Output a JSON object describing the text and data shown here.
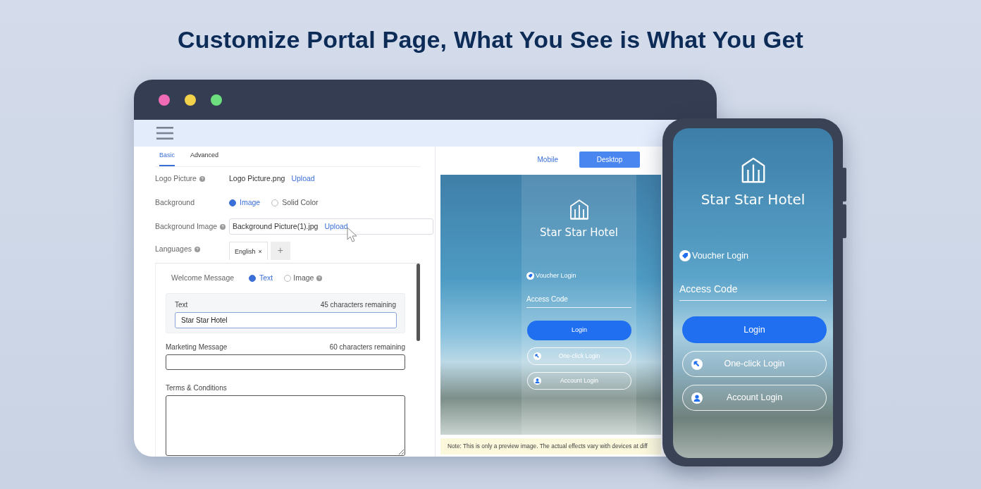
{
  "headline": "Customize Portal Page, What You See is What You Get",
  "settings": {
    "tabs": [
      {
        "label": "Basic",
        "selected": true
      },
      {
        "label": "Advanced",
        "selected": false
      }
    ],
    "logo_picture": {
      "label": "Logo Picture",
      "file": "Logo Picture.png",
      "action": "Upload"
    },
    "background": {
      "label": "Background",
      "options": [
        {
          "label": "Image",
          "selected": true
        },
        {
          "label": "Solid Color",
          "selected": false
        }
      ]
    },
    "background_image": {
      "label": "Background Image",
      "file": "Background Picture(1).jpg",
      "action": "Upload"
    },
    "languages": {
      "label": "Languages",
      "tabs": [
        {
          "label": "English",
          "close": "×"
        }
      ],
      "add": "+"
    },
    "welcome_message": {
      "label": "Welcome Message",
      "options": [
        {
          "label": "Text",
          "selected": true
        },
        {
          "label": "Image",
          "selected": false
        }
      ],
      "text_label": "Text",
      "remaining": "45 characters remaining",
      "value": "Star Star Hotel"
    },
    "marketing_message": {
      "label": "Marketing Message",
      "remaining": "60 characters remaining"
    },
    "terms": {
      "label": "Terms & Conditions"
    }
  },
  "preview": {
    "view_modes": [
      {
        "label": "Mobile",
        "selected": false
      },
      {
        "label": "Desktop",
        "selected": true
      }
    ],
    "portal": {
      "name": "Star Star Hotel",
      "voucher": "Voucher Login",
      "access_code": "Access Code",
      "login": "Login",
      "alt_logins": [
        {
          "kind": "one-click",
          "label": "One-click Login"
        },
        {
          "kind": "account",
          "label": "Account Login"
        }
      ]
    },
    "note": "Note: This is only a preview image. The actual effects vary with devices at diff"
  },
  "phone": {
    "portal": {
      "name": "Star Star Hotel",
      "voucher": "Voucher Login",
      "access_code": "Access Code",
      "login": "Login",
      "alt_logins": [
        {
          "kind": "one-click",
          "label": "One-click Login"
        },
        {
          "kind": "account",
          "label": "Account Login"
        }
      ]
    }
  }
}
